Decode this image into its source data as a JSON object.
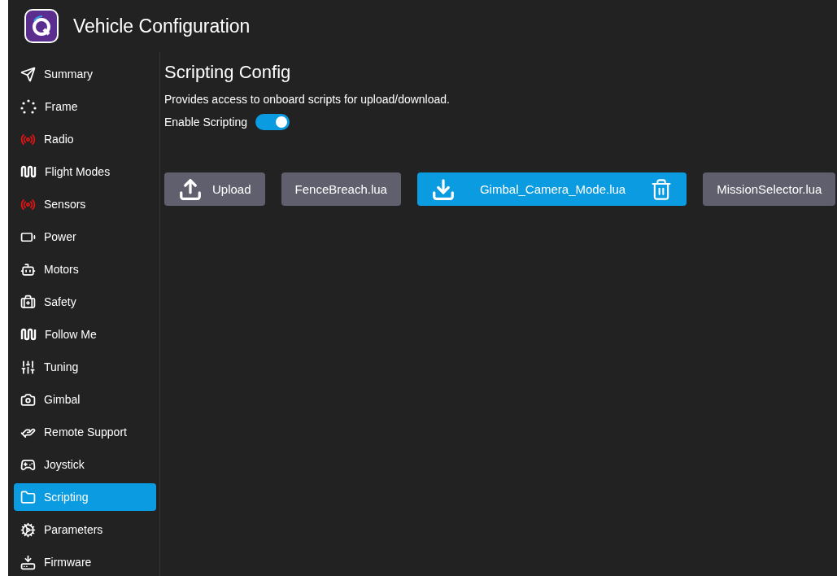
{
  "window": {
    "title": "Vehicle Configuration"
  },
  "sidebar": {
    "items": [
      {
        "label": "Summary",
        "selected": false
      },
      {
        "label": "Frame",
        "selected": false
      },
      {
        "label": "Radio",
        "selected": false
      },
      {
        "label": "Flight Modes",
        "selected": false
      },
      {
        "label": "Sensors",
        "selected": false
      },
      {
        "label": "Power",
        "selected": false
      },
      {
        "label": "Motors",
        "selected": false
      },
      {
        "label": "Safety",
        "selected": false
      },
      {
        "label": "Follow Me",
        "selected": false
      },
      {
        "label": "Tuning",
        "selected": false
      },
      {
        "label": "Gimbal",
        "selected": false
      },
      {
        "label": "Remote Support",
        "selected": false
      },
      {
        "label": "Joystick",
        "selected": false
      },
      {
        "label": "Scripting",
        "selected": true
      },
      {
        "label": "Parameters",
        "selected": false
      },
      {
        "label": "Firmware",
        "selected": false
      }
    ]
  },
  "content": {
    "title": "Scripting Config",
    "description": "Provides access to onboard scripts for upload/download.",
    "enable_scripting": {
      "label": "Enable Scripting",
      "on": true
    },
    "upload_button": "Upload",
    "scripts": [
      {
        "name": "FenceBreach.lua",
        "selected": false
      },
      {
        "name": "Gimbal_Camera_Mode.lua",
        "selected": true
      },
      {
        "name": "MissionSelector.lua",
        "selected": false
      }
    ]
  }
}
